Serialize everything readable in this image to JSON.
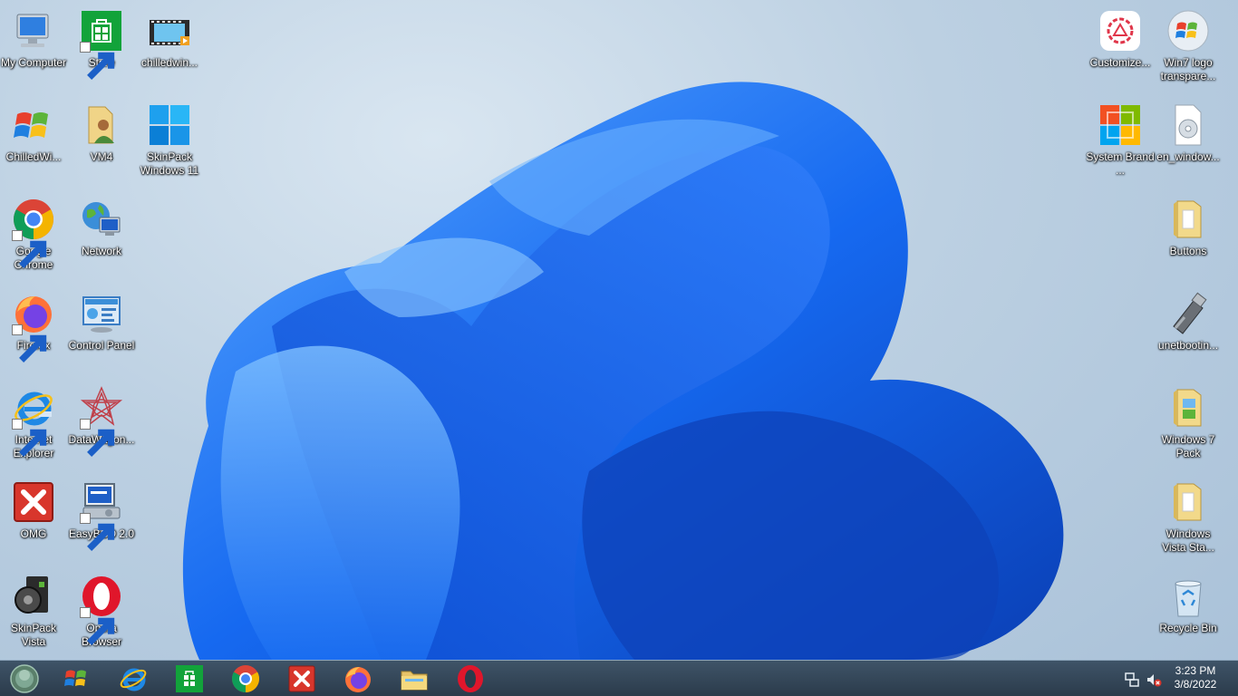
{
  "desktop": {
    "icons": [
      {
        "name": "my-computer-icon",
        "label": "My Computer",
        "shortcut": false
      },
      {
        "name": "store-icon",
        "label": "Store",
        "shortcut": true
      },
      {
        "name": "video-file-icon",
        "label": "chilledwin...",
        "shortcut": false
      },
      {
        "name": "windows-logo-icon",
        "label": "ChilledWi...",
        "shortcut": false
      },
      {
        "name": "user-folder-icon",
        "label": "VM4",
        "shortcut": false
      },
      {
        "name": "windows11-logo-icon",
        "label": "SkinPack Windows 11",
        "shortcut": false
      },
      {
        "name": "chrome-icon",
        "label": "Google Chrome",
        "shortcut": true
      },
      {
        "name": "network-icon",
        "label": "Network",
        "shortcut": false
      },
      {
        "name": "firefox-icon",
        "label": "Firefox",
        "shortcut": true
      },
      {
        "name": "control-panel-icon",
        "label": "Control Panel",
        "shortcut": false
      },
      {
        "name": "internet-explorer-icon",
        "label": "Internet Explorer",
        "shortcut": true
      },
      {
        "name": "datawagon-icon",
        "label": "DataWagon...",
        "shortcut": true
      },
      {
        "name": "omg-icon",
        "label": "OMG",
        "shortcut": false
      },
      {
        "name": "easybcd-icon",
        "label": "EasyBCD 2.0",
        "shortcut": true
      },
      {
        "name": "skinpack-vista-icon",
        "label": "SkinPack Vista",
        "shortcut": false
      },
      {
        "name": "opera-icon",
        "label": "Opera Browser",
        "shortcut": true
      },
      {
        "name": "customize-icon",
        "label": "Customize...",
        "shortcut": false
      },
      {
        "name": "win7-logo-icon",
        "label": "Win7 logo transpare...",
        "shortcut": false
      },
      {
        "name": "system-brand-icon",
        "label": "System Brand ...",
        "shortcut": false
      },
      {
        "name": "disc-image-icon",
        "label": "en_window...",
        "shortcut": false
      },
      {
        "name": "folder-icon",
        "label": "Buttons",
        "shortcut": false
      },
      {
        "name": "usb-drive-icon",
        "label": "unetbootin...",
        "shortcut": false
      },
      {
        "name": "folder-icon",
        "label": "Windows 7 Pack",
        "shortcut": false
      },
      {
        "name": "folder-icon",
        "label": "Windows Vista Sta...",
        "shortcut": false
      },
      {
        "name": "recycle-bin-icon",
        "label": "Recycle Bin",
        "shortcut": false
      }
    ]
  },
  "taskbar": {
    "pinned": [
      {
        "name": "start-orb-icon"
      },
      {
        "name": "windows-logo-icon"
      },
      {
        "name": "internet-explorer-icon"
      },
      {
        "name": "store-icon"
      },
      {
        "name": "chrome-icon"
      },
      {
        "name": "omg-icon"
      },
      {
        "name": "firefox-icon"
      },
      {
        "name": "file-explorer-icon"
      },
      {
        "name": "opera-icon"
      }
    ],
    "tray": {
      "icons": [
        {
          "name": "network-tray-icon"
        },
        {
          "name": "volume-muted-icon"
        }
      ],
      "time": "3:23 PM",
      "date": "3/8/2022"
    }
  },
  "colors": {
    "accent_blue": "#1565e0",
    "taskbar_bg": "#34475a"
  }
}
